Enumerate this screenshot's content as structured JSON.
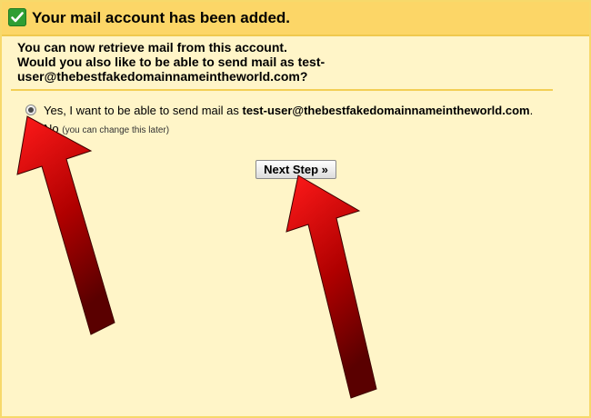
{
  "header": {
    "title": "Your mail account has been added.",
    "icon": "checkmark-icon",
    "bg_color": "#fcd667"
  },
  "intro": {
    "line1": "You can now retrieve mail from this account.",
    "line2a": "Would you also like to be able to send mail as test-",
    "line2b": "user@thebestfakedomainnameintheworld.com?"
  },
  "options": {
    "yes_prefix": "Yes, I want to be able to send mail as ",
    "yes_address": "test-user@thebestfakedomainnameintheworld.com",
    "yes_suffix": ".",
    "no_label": "No",
    "no_hint": "(you can change this later)",
    "selected": "yes"
  },
  "next_button": {
    "label": "Next Step »"
  },
  "annotations": {
    "arrow_color": "#cc0000",
    "arrow_count": 2
  }
}
